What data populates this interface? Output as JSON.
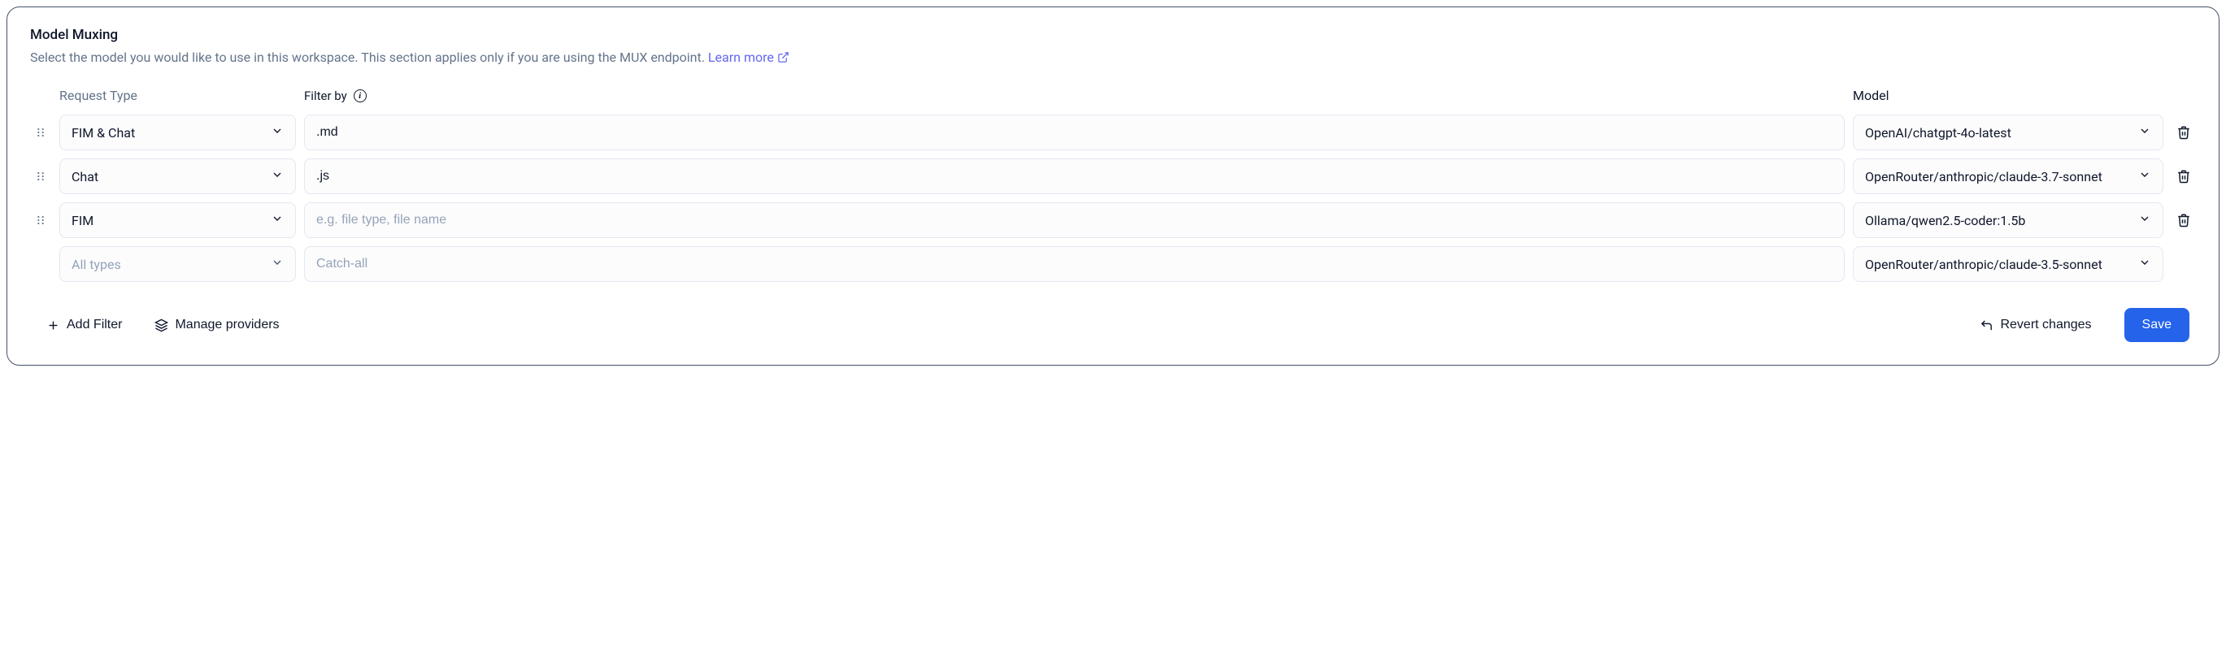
{
  "header": {
    "title": "Model Muxing",
    "description": "Select the model you would like to use in this workspace. This section applies only if you are using the MUX endpoint.",
    "learn_more_label": "Learn more"
  },
  "columns": {
    "request_type": "Request Type",
    "filter_by": "Filter by",
    "model": "Model"
  },
  "filter_placeholder": "e.g. file type, file name",
  "catch_all_placeholder": "Catch-all",
  "all_types_label": "All types",
  "rows": [
    {
      "request_type": "FIM & Chat",
      "filter": ".md",
      "model": "OpenAI/chatgpt-4o-latest",
      "draggable": true,
      "deletable": true
    },
    {
      "request_type": "Chat",
      "filter": ".js",
      "model": "OpenRouter/anthropic/claude-3.7-sonnet",
      "draggable": true,
      "deletable": true
    },
    {
      "request_type": "FIM",
      "filter": "",
      "model": "Ollama/qwen2.5-coder:1.5b",
      "draggable": true,
      "deletable": true
    }
  ],
  "catch_all_row": {
    "model": "OpenRouter/anthropic/claude-3.5-sonnet"
  },
  "footer": {
    "add_filter": "Add Filter",
    "manage_providers": "Manage providers",
    "revert": "Revert changes",
    "save": "Save"
  }
}
